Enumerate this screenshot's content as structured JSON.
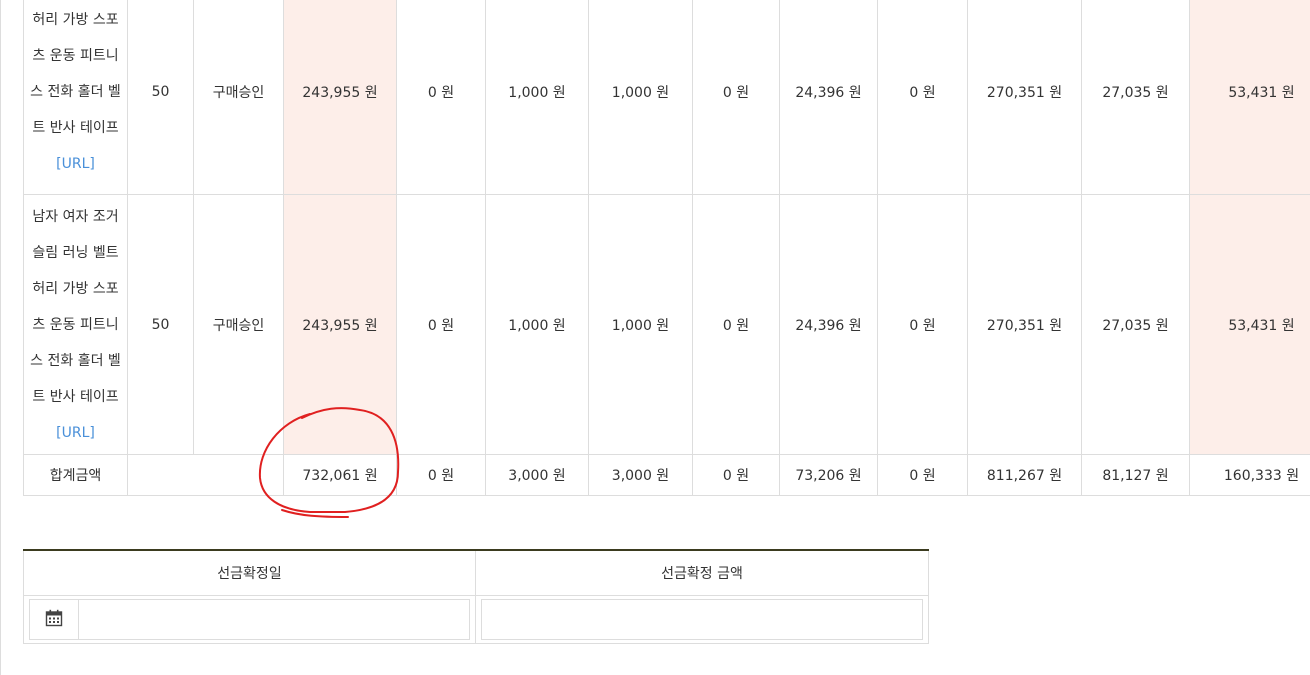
{
  "rows": [
    {
      "name_lines": [
        "허리 가방 스포",
        "츠 운동 피트니",
        "스 전화 홀더 벨",
        "트 반사 테이프"
      ],
      "url_label": "[URL]",
      "qty": "50",
      "status": "구매승인",
      "c1": "243,955 원",
      "c2": "0 원",
      "c3": "1,000 원",
      "c4": "1,000 원",
      "c5": "0 원",
      "c6": "24,396 원",
      "c7": "0 원",
      "c8": "270,351 원",
      "c9": "27,035 원",
      "c10": "53,431 원"
    },
    {
      "name_lines": [
        "남자 여자 조거",
        "슬림 러닝 벨트",
        "허리 가방 스포",
        "츠 운동 피트니",
        "스 전화 홀더 벨",
        "트 반사 테이프"
      ],
      "url_label": "[URL]",
      "qty": "50",
      "status": "구매승인",
      "c1": "243,955 원",
      "c2": "0 원",
      "c3": "1,000 원",
      "c4": "1,000 원",
      "c5": "0 원",
      "c6": "24,396 원",
      "c7": "0 원",
      "c8": "270,351 원",
      "c9": "27,035 원",
      "c10": "53,431 원"
    }
  ],
  "total": {
    "label": "합계금액",
    "c1": "732,061 원",
    "c2": "0 원",
    "c3": "3,000 원",
    "c4": "3,000 원",
    "c5": "0 원",
    "c6": "73,206 원",
    "c7": "0 원",
    "c8": "811,267 원",
    "c9": "81,127 원",
    "c10": "160,333 원"
  },
  "prepay": {
    "date_header": "선금확정일",
    "amount_header": "선금확정 금액",
    "date_value": "",
    "amount_value": ""
  },
  "icons": {
    "calendar": "calendar-icon"
  },
  "colors": {
    "highlight": "#fdeee9",
    "link": "#4a90d9",
    "annotation": "#e02020",
    "header_rule": "#3b3b1f"
  }
}
